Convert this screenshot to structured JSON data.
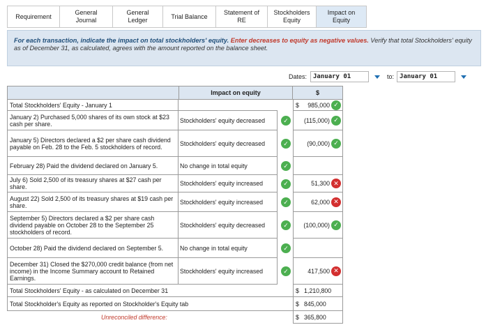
{
  "tabs": [
    {
      "label": "Requirement"
    },
    {
      "label": "General\nJournal"
    },
    {
      "label": "General\nLedger"
    },
    {
      "label": "Trial Balance"
    },
    {
      "label": "Statement of\nRE"
    },
    {
      "label": "Stockholders\nEquity"
    },
    {
      "label": "Impact on\nEquity"
    }
  ],
  "instruction": {
    "lead": "For each transaction, indicate the impact on total stockholders' equity.",
    "red": "Enter decreases to equity as negative values.",
    "rest": "Verify that total Stockholders' equity as of December 31, as calculated, agrees with the amount reported on the balance sheet."
  },
  "dates": {
    "label": "Dates:",
    "from": "January 01",
    "to_label": "to:",
    "to": "January 01"
  },
  "table": {
    "header": "Impact on equity",
    "dollar_header": "$",
    "rows": [
      {
        "desc": "Total Stockholders' Equity - January 1",
        "impact": "",
        "amount": "985,000",
        "dollar": "$",
        "status": "check",
        "impact_check": false
      },
      {
        "desc": "January 2) Purchased 5,000 shares of its own stock at $23 cash per share.",
        "impact": "Stockholders' equity decreased",
        "amount": "(115,000)",
        "dollar": "",
        "status": "check",
        "impact_check": true
      },
      {
        "desc": "January 5) Directors declared a $2 per share cash dividend payable on Feb. 28 to the Feb. 5 stockholders of record.",
        "impact": "Stockholders' equity decreased",
        "amount": "(90,000)",
        "dollar": "",
        "status": "check",
        "impact_check": true
      },
      {
        "desc": "February 28) Paid the dividend declared on January 5.",
        "impact": "No change in total equity",
        "amount": "",
        "dollar": "",
        "status": "",
        "impact_check": true
      },
      {
        "desc": "July 6) Sold 2,500 of its treasury shares at $27 cash per share.",
        "impact": "Stockholders' equity increased",
        "amount": "51,300",
        "dollar": "",
        "status": "cross",
        "impact_check": true
      },
      {
        "desc": "August 22) Sold 2,500 of its treasury shares at $19 cash per share.",
        "impact": "Stockholders' equity increased",
        "amount": "62,000",
        "dollar": "",
        "status": "cross",
        "impact_check": true
      },
      {
        "desc": "September 5) Directors declared a $2 per share cash dividend payable on October 28 to the September 25 stockholders of record.",
        "impact": "Stockholders' equity decreased",
        "amount": "(100,000)",
        "dollar": "",
        "status": "check",
        "impact_check": true
      },
      {
        "desc": "October 28) Paid the dividend declared on September 5.",
        "impact": "No change in total equity",
        "amount": "",
        "dollar": "",
        "status": "",
        "impact_check": true
      },
      {
        "desc": "December 31) Closed the $270,000 credit balance (from net income) in the Income Summary account to Retained Earnings.",
        "impact": "Stockholders' equity increased",
        "amount": "417,500",
        "dollar": "",
        "status": "cross",
        "impact_check": true
      }
    ],
    "total_calc": {
      "label": "Total Stockholders' Equity - as calculated on December 31",
      "dollar": "$",
      "amount": "1,210,800"
    },
    "total_reported": {
      "label": "Total Stockholder's Equity as reported on Stockholder's Equity tab",
      "dollar": "$",
      "amount": "845,000"
    },
    "unreconciled": {
      "label": "Unreconciled difference:",
      "dollar": "$",
      "amount": "365,800"
    }
  }
}
